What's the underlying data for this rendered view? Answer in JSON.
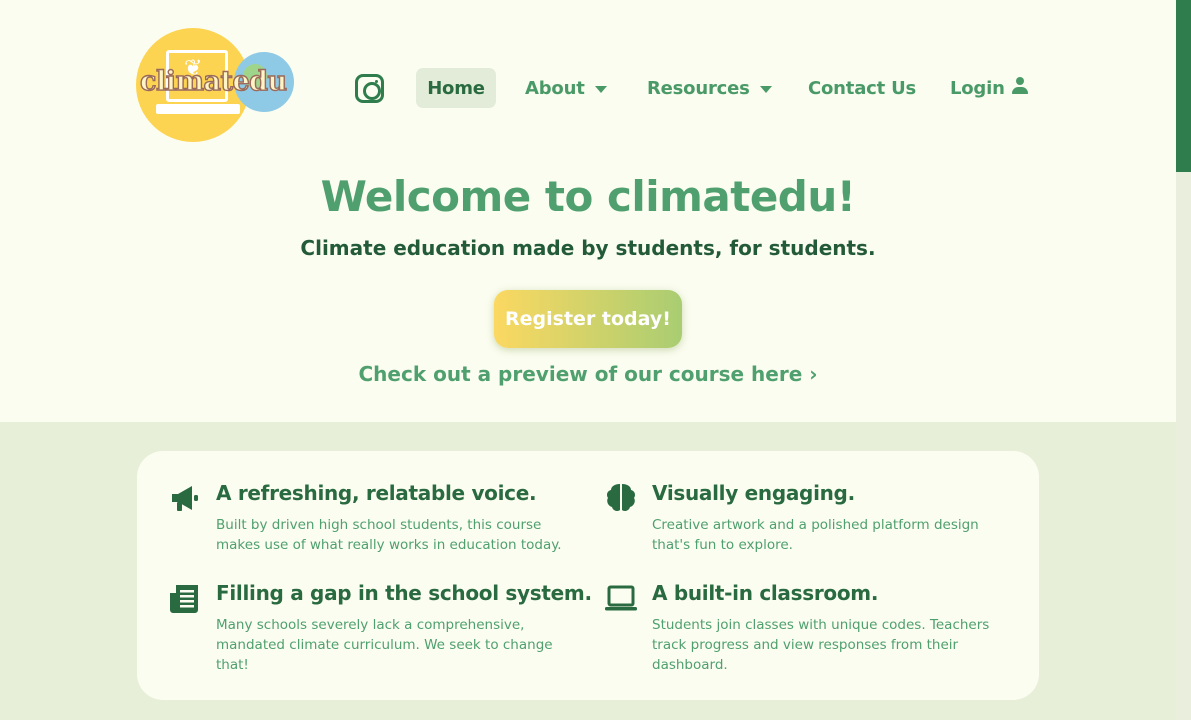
{
  "brand": {
    "logo_text": "climatedu"
  },
  "nav": {
    "instagram_icon": "instagram-icon",
    "items": [
      {
        "label": "Home",
        "active": true
      },
      {
        "label": "About",
        "has_dropdown": true
      },
      {
        "label": "Resources",
        "has_dropdown": true
      },
      {
        "label": "Contact Us"
      },
      {
        "label": "Login",
        "icon": "user-icon"
      }
    ]
  },
  "hero": {
    "title": "Welcome to climatedu!",
    "subtitle": "Climate education made by students, for students.",
    "cta_label": "Register today!",
    "preview_link": "Check out a preview of our course here ›"
  },
  "features": [
    {
      "icon": "megaphone-icon",
      "title": "A refreshing, relatable voice.",
      "desc": "Built by driven high school students, this course makes use of what really works in education today."
    },
    {
      "icon": "brain-icon",
      "title": "Visually engaging.",
      "desc": "Creative artwork and a polished platform design that's fun to explore."
    },
    {
      "icon": "newspaper-icon",
      "title": "Filling a gap in the school system.",
      "desc": "Many schools severely lack a comprehensive, mandated climate curriculum. We seek to change that!"
    },
    {
      "icon": "laptop-icon",
      "title": "A built-in classroom.",
      "desc": "Students join classes with unique codes. Teachers track progress and view responses from their dashboard."
    }
  ],
  "colors": {
    "primary_green": "#4fa06e",
    "dark_green": "#2a6a40",
    "background": "#fbfdf0",
    "section_bg": "#e8efd9",
    "cta_gradient_start": "#fbd861",
    "cta_gradient_end": "#a9cd72"
  }
}
